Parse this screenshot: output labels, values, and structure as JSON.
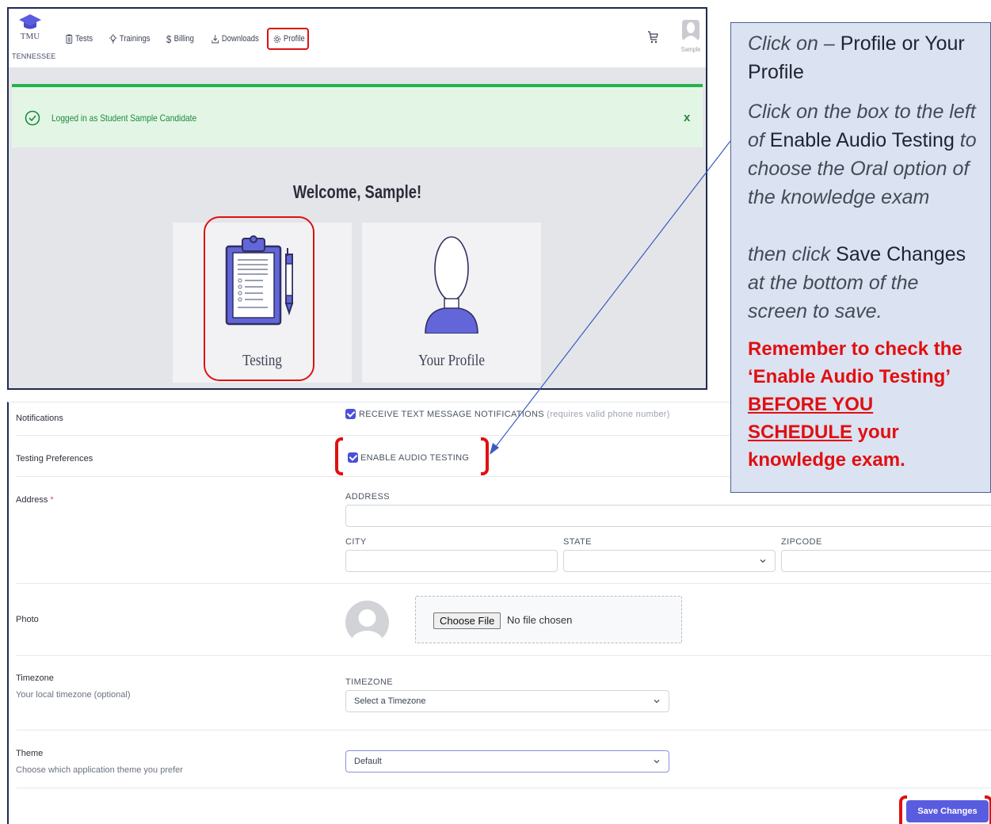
{
  "navbar": {
    "brand_name": "TMU",
    "brand_state": "TENNESSEE",
    "items": [
      {
        "label": "Tests",
        "icon": "clipboard-icon"
      },
      {
        "label": "Trainings",
        "icon": "lightbulb-icon"
      },
      {
        "label": "Billing",
        "icon": "dollar-icon"
      },
      {
        "label": "Downloads",
        "icon": "download-icon"
      },
      {
        "label": "Profile",
        "icon": "gear-icon"
      }
    ],
    "cart_icon": "cart-icon",
    "user_label": "Sample"
  },
  "alert": {
    "text": "Logged in as Student Sample Candidate",
    "close": "x",
    "color": "#24b34a"
  },
  "dashboard": {
    "welcome": "Welcome, Sample!",
    "cards": [
      {
        "label": "Testing",
        "icon": "clipboard-checklist-icon"
      },
      {
        "label": "Your Profile",
        "icon": "person-silhouette-icon"
      }
    ]
  },
  "form": {
    "notifications": {
      "label": "Notifications",
      "checkbox_label": "RECEIVE TEXT MESSAGE NOTIFICATIONS",
      "checkbox_hint": "(requires valid phone number)",
      "checked": true
    },
    "testing_preferences": {
      "label": "Testing Preferences",
      "checkbox_label": "ENABLE AUDIO TESTING",
      "checked": true
    },
    "address": {
      "label": "Address",
      "required_mark": "*",
      "address_label": "ADDRESS",
      "address_value": "",
      "city_label": "CITY",
      "city_value": "",
      "state_label": "STATE",
      "state_value": "",
      "zipcode_label": "ZIPCODE",
      "zipcode_value": ""
    },
    "photo": {
      "label": "Photo",
      "choose_button": "Choose File",
      "file_status": "No file chosen"
    },
    "timezone": {
      "label": "Timezone",
      "description": "Your local timezone (optional)",
      "field_label": "TIMEZONE",
      "value": "Select a Timezone"
    },
    "theme": {
      "label": "Theme",
      "description": "Choose which application theme you prefer",
      "value": "Default"
    },
    "save_button": "Save Changes",
    "accent_color": "#5a5ce0"
  },
  "callout": {
    "p1_italic": "Click on – ",
    "p1_normal": "Profile or Your Profile",
    "p2_italic_a": "Click on the box to the left of ",
    "p2_normal": "Enable Audio Testing",
    "p2_italic_b": " to choose the Oral option of the knowledge exam",
    "p3_italic_a": "then click ",
    "p3_normal": "Save Changes",
    "p3_italic_b": " at the bottom of the screen to save.",
    "warn_a": "Remember to check the ‘Enable Audio Testing’ ",
    "warn_underline": "BEFORE YOU SCHEDULE",
    "warn_b": " your knowledge exam.",
    "warn_color": "#e01010"
  }
}
